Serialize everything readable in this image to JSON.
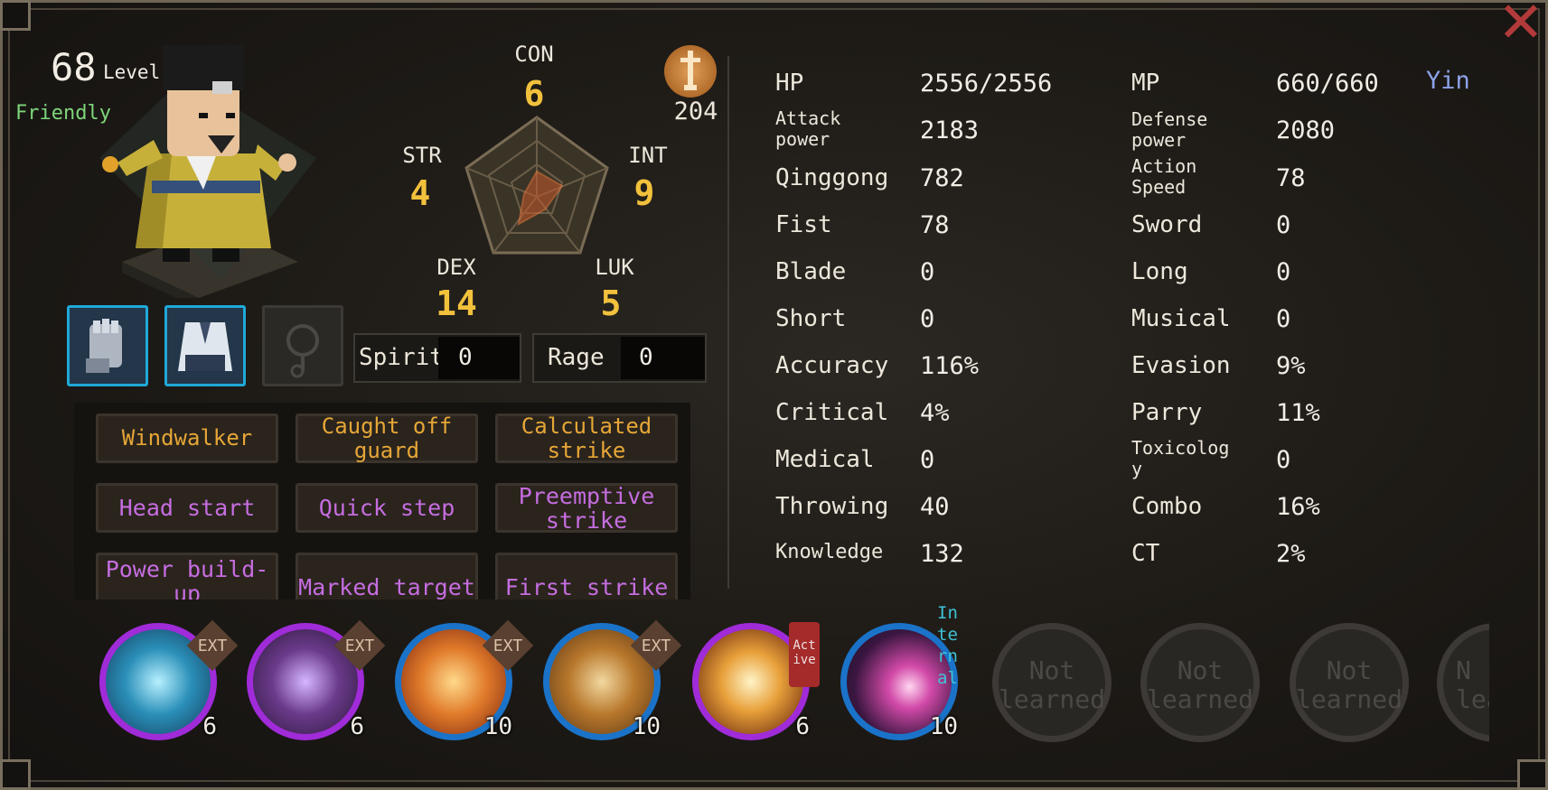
{
  "character": {
    "level": "68",
    "level_label": "Level",
    "attitude": "Friendly",
    "emblem_value": "204"
  },
  "core_stats": {
    "con": {
      "label": "CON",
      "value": "6"
    },
    "str": {
      "label": "STR",
      "value": "4"
    },
    "int": {
      "label": "INT",
      "value": "9"
    },
    "dex": {
      "label": "DEX",
      "value": "14"
    },
    "luk": {
      "label": "LUK",
      "value": "5"
    }
  },
  "meters": {
    "spirit": {
      "label": "Spirit",
      "value": "0"
    },
    "rage": {
      "label": "Rage",
      "value": "0"
    }
  },
  "equipment": [
    {
      "slot": "gauntlet-icon",
      "equipped": true
    },
    {
      "slot": "robe-icon",
      "equipped": true
    },
    {
      "slot": "accessory-icon",
      "equipped": false
    }
  ],
  "traits": [
    {
      "label": "Windwalker",
      "color": "#e6a637"
    },
    {
      "label": "Caught off guard",
      "color": "#e6a637"
    },
    {
      "label": "Calculated strike",
      "color": "#e6a637"
    },
    {
      "label": "Head start",
      "color": "#c66de0"
    },
    {
      "label": "Quick step",
      "color": "#c66de0"
    },
    {
      "label": "Preemptive strike",
      "color": "#c66de0"
    },
    {
      "label": "Power build-up",
      "color": "#c66de0"
    },
    {
      "label": "Marked target",
      "color": "#c66de0"
    },
    {
      "label": "First strike",
      "color": "#c66de0"
    }
  ],
  "attributes_left": [
    {
      "label": "HP",
      "value": "2556/2556"
    },
    {
      "label": "Attack power",
      "value": "2183"
    },
    {
      "label": "Qinggong",
      "value": "782"
    },
    {
      "label": "Fist",
      "value": "78"
    },
    {
      "label": "Blade",
      "value": "0"
    },
    {
      "label": "Short",
      "value": "0"
    },
    {
      "label": "Accuracy",
      "value": "116%"
    },
    {
      "label": "Critical",
      "value": "4%"
    },
    {
      "label": "Medical",
      "value": "0"
    },
    {
      "label": "Throwing",
      "value": "40"
    },
    {
      "label": "Knowledge",
      "value": "132"
    }
  ],
  "attributes_right": [
    {
      "label": "MP",
      "value": "660/660"
    },
    {
      "label": "Defense power",
      "value": "2080"
    },
    {
      "label": "Action Speed",
      "value": "78"
    },
    {
      "label": "Sword",
      "value": "0"
    },
    {
      "label": "Long",
      "value": "0"
    },
    {
      "label": "Musical",
      "value": "0"
    },
    {
      "label": "Evasion",
      "value": "9%"
    },
    {
      "label": "Parry",
      "value": "11%"
    },
    {
      "label": "Toxicology",
      "value": "0"
    },
    {
      "label": "Combo",
      "value": "16%"
    },
    {
      "label": "CT",
      "value": "2%"
    }
  ],
  "yin_label": "Yin",
  "skills": [
    {
      "icon": "palm-wave-skill-icon",
      "level": "6",
      "tag": "EXT",
      "ring": "#a02bd8"
    },
    {
      "icon": "claw-skill-icon",
      "level": "6",
      "tag": "EXT",
      "ring": "#a02bd8"
    },
    {
      "icon": "fist-skill-icon",
      "level": "10",
      "tag": "EXT",
      "ring": "#1a73c8"
    },
    {
      "icon": "ear-skill-icon",
      "level": "10",
      "tag": "EXT",
      "ring": "#1a73c8"
    },
    {
      "icon": "lightning-skill-icon",
      "level": "6",
      "tag": "Active",
      "ring": "#a02bd8"
    },
    {
      "icon": "comet-skill-icon",
      "level": "10",
      "tag": "Internal",
      "ring": "#1a73c8"
    }
  ],
  "skill_tags": {
    "ext": "EXT",
    "active_1": "Act",
    "active_2": "ive",
    "internal_1": "In",
    "internal_2": "te",
    "internal_3": "rn",
    "internal_4": "al"
  },
  "not_learned": {
    "line1": "Not",
    "line2": "learned",
    "partial_line1": "N",
    "partial_line2": "lea"
  }
}
